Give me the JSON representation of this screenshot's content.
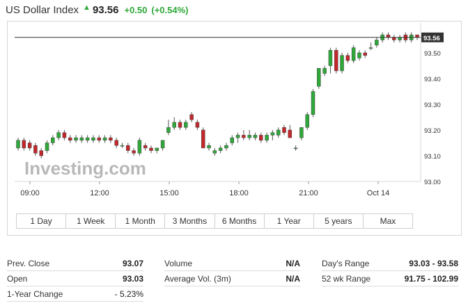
{
  "header": {
    "title": "US Dollar Index",
    "arrow_icon": "triangle-up-icon",
    "price": "93.56",
    "change": "+0.50",
    "change_pct": "(+0.54%)",
    "up_color": "#2ea838",
    "down_color": "#c3272b"
  },
  "chart_data": {
    "type": "candlestick",
    "title": "",
    "watermark": "Investing.com",
    "x_tick_labels": [
      "09:00",
      "12:00",
      "15:00",
      "18:00",
      "21:00",
      "Oct 14"
    ],
    "y_tick_labels": [
      "93.56",
      "93.50",
      "93.40",
      "93.30",
      "93.20",
      "93.10",
      "93.00"
    ],
    "ylim": [
      93.0,
      93.6
    ],
    "last_price": 93.56,
    "grid": false,
    "candles": [
      {
        "o": 93.13,
        "h": 93.17,
        "l": 93.12,
        "c": 93.16
      },
      {
        "o": 93.16,
        "h": 93.17,
        "l": 93.12,
        "c": 93.13
      },
      {
        "o": 93.15,
        "h": 93.16,
        "l": 93.12,
        "c": 93.13
      },
      {
        "o": 93.14,
        "h": 93.15,
        "l": 93.1,
        "c": 93.11
      },
      {
        "o": 93.12,
        "h": 93.13,
        "l": 93.09,
        "c": 93.1
      },
      {
        "o": 93.12,
        "h": 93.16,
        "l": 93.11,
        "c": 93.15
      },
      {
        "o": 93.15,
        "h": 93.18,
        "l": 93.14,
        "c": 93.17
      },
      {
        "o": 93.17,
        "h": 93.2,
        "l": 93.16,
        "c": 93.19
      },
      {
        "o": 93.19,
        "h": 93.2,
        "l": 93.16,
        "c": 93.17
      },
      {
        "o": 93.17,
        "h": 93.18,
        "l": 93.15,
        "c": 93.16
      },
      {
        "o": 93.16,
        "h": 93.18,
        "l": 93.15,
        "c": 93.17
      },
      {
        "o": 93.16,
        "h": 93.18,
        "l": 93.15,
        "c": 93.17
      },
      {
        "o": 93.16,
        "h": 93.18,
        "l": 93.15,
        "c": 93.17
      },
      {
        "o": 93.16,
        "h": 93.18,
        "l": 93.15,
        "c": 93.17
      },
      {
        "o": 93.17,
        "h": 93.18,
        "l": 93.15,
        "c": 93.16
      },
      {
        "o": 93.16,
        "h": 93.18,
        "l": 93.15,
        "c": 93.17
      },
      {
        "o": 93.17,
        "h": 93.18,
        "l": 93.15,
        "c": 93.16
      },
      {
        "o": 93.16,
        "h": 93.17,
        "l": 93.13,
        "c": 93.14
      },
      {
        "o": 93.14,
        "h": 93.15,
        "l": 93.13,
        "c": 93.14
      },
      {
        "o": 93.14,
        "h": 93.15,
        "l": 93.11,
        "c": 93.12
      },
      {
        "o": 93.12,
        "h": 93.13,
        "l": 93.1,
        "c": 93.11
      },
      {
        "o": 93.11,
        "h": 93.17,
        "l": 93.1,
        "c": 93.16
      },
      {
        "o": 93.14,
        "h": 93.15,
        "l": 93.12,
        "c": 93.13
      },
      {
        "o": 93.13,
        "h": 93.14,
        "l": 93.11,
        "c": 93.12
      },
      {
        "o": 93.12,
        "h": 93.13,
        "l": 93.11,
        "c": 93.13
      },
      {
        "o": 93.13,
        "h": 93.16,
        "l": 93.12,
        "c": 93.16
      },
      {
        "o": 93.19,
        "h": 93.24,
        "l": 93.18,
        "c": 93.21
      },
      {
        "o": 93.21,
        "h": 93.25,
        "l": 93.2,
        "c": 93.23
      },
      {
        "o": 93.23,
        "h": 93.24,
        "l": 93.2,
        "c": 93.21
      },
      {
        "o": 93.21,
        "h": 93.24,
        "l": 93.2,
        "c": 93.23
      },
      {
        "o": 93.26,
        "h": 93.27,
        "l": 93.23,
        "c": 93.24
      },
      {
        "o": 93.23,
        "h": 93.24,
        "l": 93.2,
        "c": 93.21
      },
      {
        "o": 93.2,
        "h": 93.21,
        "l": 93.13,
        "c": 93.13
      },
      {
        "o": 93.13,
        "h": 93.15,
        "l": 93.12,
        "c": 93.14
      },
      {
        "o": 93.11,
        "h": 93.13,
        "l": 93.1,
        "c": 93.12
      },
      {
        "o": 93.12,
        "h": 93.14,
        "l": 93.11,
        "c": 93.13
      },
      {
        "o": 93.13,
        "h": 93.15,
        "l": 93.12,
        "c": 93.14
      },
      {
        "o": 93.15,
        "h": 93.18,
        "l": 93.14,
        "c": 93.17
      },
      {
        "o": 93.17,
        "h": 93.19,
        "l": 93.15,
        "c": 93.18
      },
      {
        "o": 93.18,
        "h": 93.2,
        "l": 93.16,
        "c": 93.17
      },
      {
        "o": 93.17,
        "h": 93.2,
        "l": 93.16,
        "c": 93.18
      },
      {
        "o": 93.17,
        "h": 93.19,
        "l": 93.16,
        "c": 93.18
      },
      {
        "o": 93.18,
        "h": 93.19,
        "l": 93.15,
        "c": 93.16
      },
      {
        "o": 93.16,
        "h": 93.19,
        "l": 93.15,
        "c": 93.18
      },
      {
        "o": 93.18,
        "h": 93.2,
        "l": 93.16,
        "c": 93.19
      },
      {
        "o": 93.18,
        "h": 93.21,
        "l": 93.17,
        "c": 93.2
      },
      {
        "o": 93.21,
        "h": 93.22,
        "l": 93.18,
        "c": 93.19
      },
      {
        "o": 93.2,
        "h": 93.22,
        "l": 93.17,
        "c": 93.17
      },
      {
        "o": 93.13,
        "h": 93.14,
        "l": 93.12,
        "c": 93.13
      },
      {
        "o": 93.17,
        "h": 93.21,
        "l": 93.16,
        "c": 93.21
      },
      {
        "o": 93.21,
        "h": 93.27,
        "l": 93.2,
        "c": 93.26
      },
      {
        "o": 93.26,
        "h": 93.36,
        "l": 93.25,
        "c": 93.35
      },
      {
        "o": 93.37,
        "h": 93.44,
        "l": 93.36,
        "c": 93.44
      },
      {
        "o": 93.42,
        "h": 93.45,
        "l": 93.41,
        "c": 93.44
      },
      {
        "o": 93.45,
        "h": 93.52,
        "l": 93.42,
        "c": 93.51
      },
      {
        "o": 93.51,
        "h": 93.52,
        "l": 93.42,
        "c": 93.43
      },
      {
        "o": 93.43,
        "h": 93.5,
        "l": 93.42,
        "c": 93.49
      },
      {
        "o": 93.49,
        "h": 93.5,
        "l": 93.46,
        "c": 93.47
      },
      {
        "o": 93.47,
        "h": 93.53,
        "l": 93.46,
        "c": 93.52
      },
      {
        "o": 93.48,
        "h": 93.51,
        "l": 93.47,
        "c": 93.5
      },
      {
        "o": 93.5,
        "h": 93.51,
        "l": 93.48,
        "c": 93.49
      },
      {
        "o": 93.52,
        "h": 93.54,
        "l": 93.51,
        "c": 93.52
      },
      {
        "o": 93.53,
        "h": 93.56,
        "l": 93.52,
        "c": 93.55
      },
      {
        "o": 93.55,
        "h": 93.58,
        "l": 93.54,
        "c": 93.57
      },
      {
        "o": 93.57,
        "h": 93.58,
        "l": 93.55,
        "c": 93.56
      },
      {
        "o": 93.56,
        "h": 93.57,
        "l": 93.54,
        "c": 93.55
      },
      {
        "o": 93.55,
        "h": 93.57,
        "l": 93.54,
        "c": 93.56
      },
      {
        "o": 93.57,
        "h": 93.58,
        "l": 93.54,
        "c": 93.55
      },
      {
        "o": 93.55,
        "h": 93.58,
        "l": 93.54,
        "c": 93.57
      },
      {
        "o": 93.57,
        "h": 93.57,
        "l": 93.55,
        "c": 93.56
      }
    ]
  },
  "timeframes": [
    "1 Day",
    "1 Week",
    "1 Month",
    "3 Months",
    "6 Months",
    "1 Year",
    "5 years",
    "Max"
  ],
  "stats": {
    "col1": [
      {
        "label": "Prev. Close",
        "value": "93.07"
      },
      {
        "label": "Open",
        "value": "93.03"
      },
      {
        "label": "1-Year Change",
        "value": "- 5.23%"
      }
    ],
    "col2": [
      {
        "label": "Volume",
        "value": "N/A"
      },
      {
        "label": "Average Vol. (3m)",
        "value": "N/A"
      }
    ],
    "col3": [
      {
        "label": "Day's Range",
        "value": "93.03 - 93.58"
      },
      {
        "label": "52 wk Range",
        "value": "91.75 - 102.99"
      }
    ]
  }
}
